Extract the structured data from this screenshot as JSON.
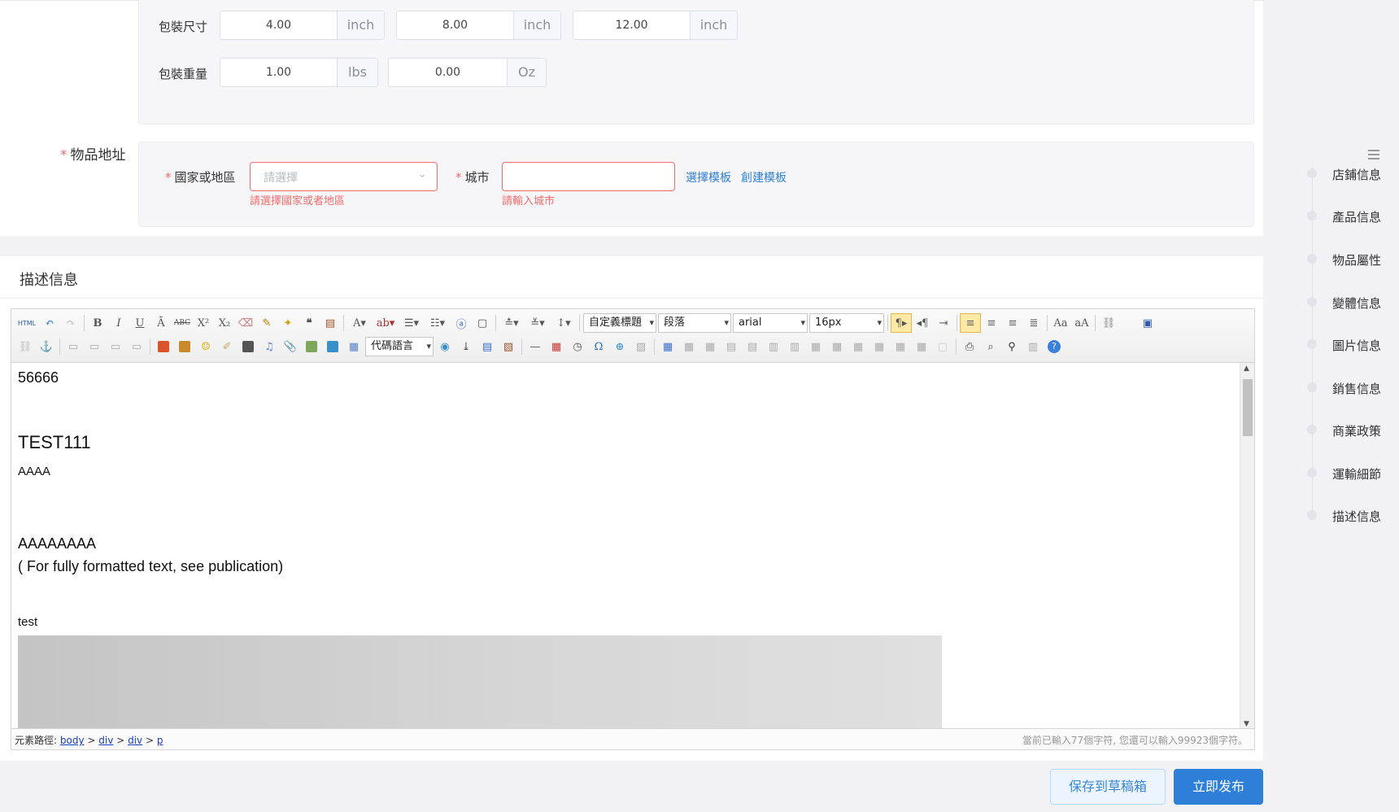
{
  "package": {
    "size_label": "包裝尺寸",
    "size": [
      {
        "value": "4.00",
        "unit": "inch"
      },
      {
        "value": "8.00",
        "unit": "inch"
      },
      {
        "value": "12.00",
        "unit": "inch"
      }
    ],
    "weight_label": "包裝重量",
    "weight": [
      {
        "value": "1.00",
        "unit": "lbs"
      },
      {
        "value": "0.00",
        "unit": "Oz"
      }
    ]
  },
  "address": {
    "required_mark": "*",
    "section_label": "物品地址",
    "country_label": "國家或地區",
    "country_placeholder": "請選擇",
    "country_error": "請選擇國家或者地區",
    "city_label": "城市",
    "city_value": "",
    "city_error": "請輸入城市",
    "choose_template": "選擇模板",
    "create_template": "創建模板"
  },
  "description": {
    "title": "描述信息",
    "toolbar": {
      "html_label": "HTML",
      "heading_combo": "自定義標題",
      "paragraph_combo": "段落",
      "font_combo": "arial",
      "size_combo": "16px",
      "code_combo": "代碼語言"
    },
    "content": {
      "line1": "56666",
      "heading": "TEST111",
      "line2": "AAAA",
      "line3": "AAAAAAAA",
      "line4": "( For fully formatted text, see publication)",
      "line5": "test"
    },
    "status": {
      "path_label": "元素路徑:",
      "path": [
        "body",
        "div",
        "div",
        "p"
      ],
      "path_sep": ">",
      "count_text": "當前已輸入77個字符, 您還可以輸入99923個字符。"
    }
  },
  "nav": {
    "items": [
      "店鋪信息",
      "產品信息",
      "物品屬性",
      "變體信息",
      "圖片信息",
      "銷售信息",
      "商業政策",
      "運輸細節",
      "描述信息"
    ]
  },
  "actions": {
    "save_draft": "保存到草稿箱",
    "publish": "立即发布"
  },
  "colors": {
    "primary": "#2d7fd8",
    "error": "#f56c6c"
  }
}
